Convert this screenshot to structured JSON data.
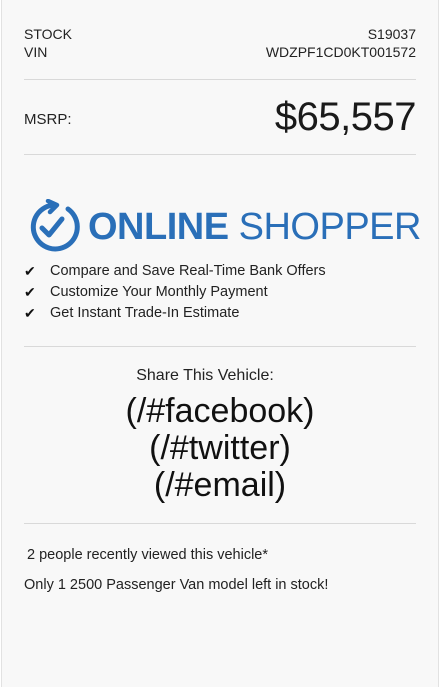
{
  "vehicle": {
    "stock_label": "STOCK",
    "stock_value": "S19037",
    "vin_label": "VIN",
    "vin_value": "WDZPF1CD0KT001572",
    "msrp_label": "MSRP:",
    "msrp_value": "$65,557"
  },
  "online_shopper": {
    "icon": "clock-check-icon",
    "brand_bold": "ONLINE",
    "brand_light": "SHOPPER",
    "accent_color": "#2a6fb8",
    "features": [
      "Compare and Save Real-Time Bank Offers",
      "Customize Your Monthly Payment",
      "Get Instant Trade-In Estimate"
    ]
  },
  "share": {
    "label": "Share This Vehicle:",
    "links": [
      "(/#facebook)",
      "(/#twitter)",
      "(/#email)"
    ]
  },
  "notices": {
    "viewed": "2 people recently viewed this vehicle*",
    "stock_note": "Only 1 2500 Passenger Van model left in stock!"
  }
}
